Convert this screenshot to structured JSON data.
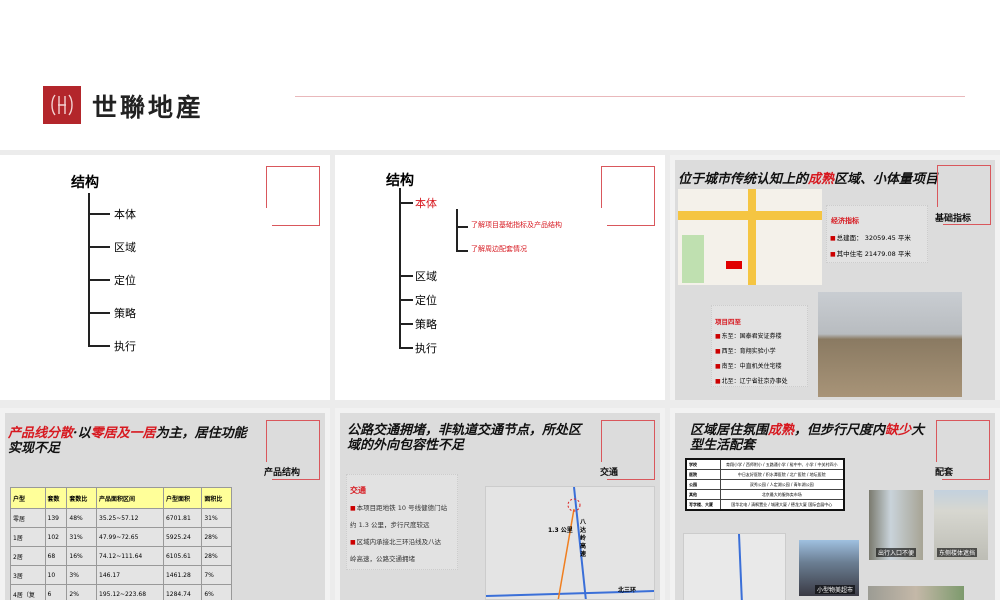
{
  "header": {
    "logo_text": "世聯地産"
  },
  "slides": [
    {
      "title": "结构",
      "items": [
        "本体",
        "区域",
        "定位",
        "策略",
        "执行"
      ]
    },
    {
      "title": "结构",
      "active_item": "本体",
      "sub_items": [
        "了解项目基础指标及产品结构",
        "了解周边配套情况"
      ],
      "items": [
        "区域",
        "定位",
        "策略",
        "执行"
      ]
    },
    {
      "title_pre": "位于城市传统认知上的",
      "title_red": "成熟",
      "title_post": "区域、小体量项目",
      "side_label": "基础指标",
      "econ": {
        "heading": "经济指标",
        "lines": [
          "总建面： 32059.45 平米",
          "其中住宅 21479.08 平米"
        ]
      },
      "bounds": {
        "heading": "项目四至",
        "lines": [
          "东至：国泰君安证券楼",
          "西至：育翔实验小学",
          "南至：中直机关住宅楼",
          "北至：辽宁省驻京办事处"
        ]
      }
    },
    {
      "title_red1": "产品线分散",
      "title_mid1": "·以",
      "title_red2": "零居及一居",
      "title_post": "为主，居住功能",
      "title_line2": "实现不足",
      "side_label": "产品结构",
      "table": {
        "headers": [
          "户型",
          "套数",
          "套数比",
          "产品面积区间",
          "户型面积",
          "面积比"
        ],
        "rows": [
          [
            "零居",
            "139",
            "48%",
            "35.25~57.12",
            "6701.81",
            "31%"
          ],
          [
            "1居",
            "102",
            "31%",
            "47.99~72.65",
            "5925.24",
            "28%"
          ],
          [
            "2居",
            "68",
            "16%",
            "74.12~111.64",
            "6105.61",
            "28%"
          ],
          [
            "3居",
            "10",
            "3%",
            "146.17",
            "1461.28",
            "7%"
          ],
          [
            "4居（复",
            "6",
            "2%",
            "195.12~223.68",
            "1284.74",
            "6%"
          ]
        ]
      }
    },
    {
      "title_line1": "公路交通拥堵，非轨道交通节点，所处区",
      "title_line2": "域的外向包容性不足",
      "side_label": "交通",
      "box_heading": "交通",
      "box_lines": [
        "本项目距地铁 10 号线健德门站",
        "约 1.3 公里，步行尺度较远",
        "区域内承接北三环沿线及八达",
        "岭高速，公路交通拥堵"
      ],
      "map_labels": {
        "distance": "1.3 公里",
        "highway": "八达岭高速",
        "ring": "北三环"
      }
    },
    {
      "title_pre": "区域居住氛围",
      "title_red1": "成熟",
      "title_mid": "，但步行尺度内",
      "title_red2": "缺少",
      "title_post": "大",
      "title_line2": "型生活配套",
      "side_label": "配套",
      "table": [
        [
          "学校",
          "育翔小学 / 西师附小 / 五路通小学 / 裕中中、小学 / 中关村四小"
        ],
        [
          "医院",
          "中日友好医院 / 积水潭医院 / 北广医院 / 地坛医院"
        ],
        [
          "公园",
          "双秀公园 / 人定湖公园 / 青年湖公园"
        ],
        [
          "其他",
          "北京最大的服饰卖市场"
        ],
        [
          "写字楼、大厦",
          "国华北电 / 清枫置业 / 城建大厦 / 德龙大厦 国际会展中心"
        ]
      ],
      "photo_captions": [
        "出行入口不便",
        "东侧楼体遮挡",
        "小型物美超市"
      ]
    }
  ]
}
